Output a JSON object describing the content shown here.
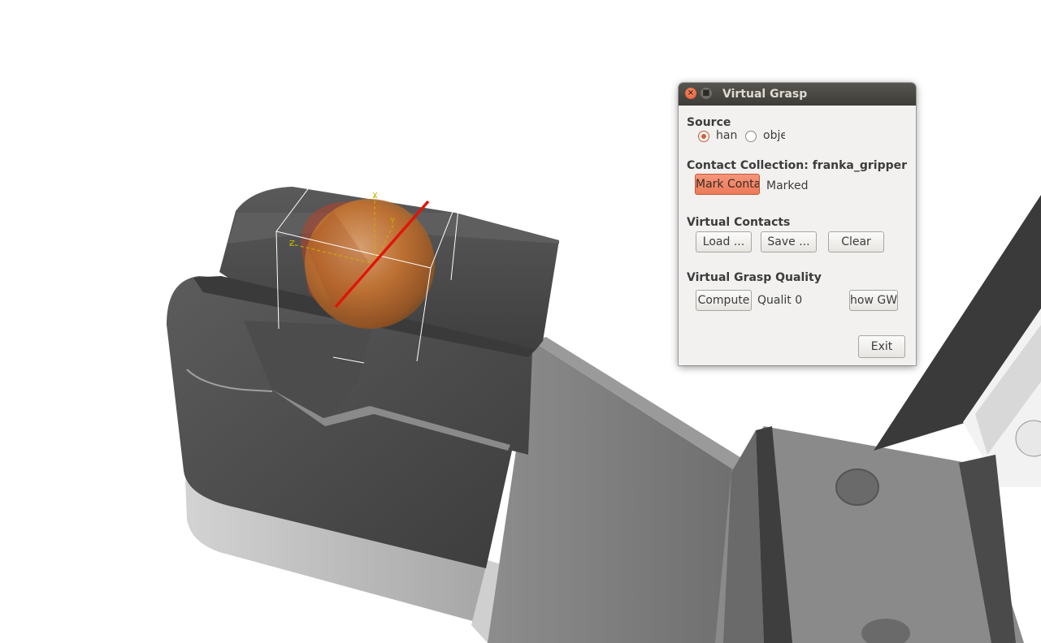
{
  "dialog": {
    "title": "Virtual Grasp",
    "close_glyph": "×",
    "min_glyph": "■",
    "source": {
      "heading": "Source",
      "options": [
        {
          "label": "han",
          "checked": true
        },
        {
          "label": "obje",
          "checked": false
        }
      ]
    },
    "contact_collection": {
      "heading": "Contact Collection: franka_gripper",
      "mark_button": "Mark Contac",
      "status": "Marked"
    },
    "virtual_contacts": {
      "heading": "Virtual Contacts",
      "load_button": "Load ...",
      "save_button": "Save ...",
      "clear_button": "Clear"
    },
    "grasp_quality": {
      "heading": "Virtual Grasp Quality",
      "compute_button": "Compute",
      "quality_label": "Qualit 0",
      "show_gws_button": "how GW"
    },
    "exit_button": "Exit"
  },
  "scene": {
    "axis_labels": {
      "x": "X",
      "y": "Y",
      "z": "Z"
    },
    "colors": {
      "gripper_dark": "#4a4a4a",
      "gripper_light": "#bdbdbd",
      "sphere": "#c97a32",
      "axis_line": "#e0150a",
      "accent": "#ec7a5a"
    }
  }
}
